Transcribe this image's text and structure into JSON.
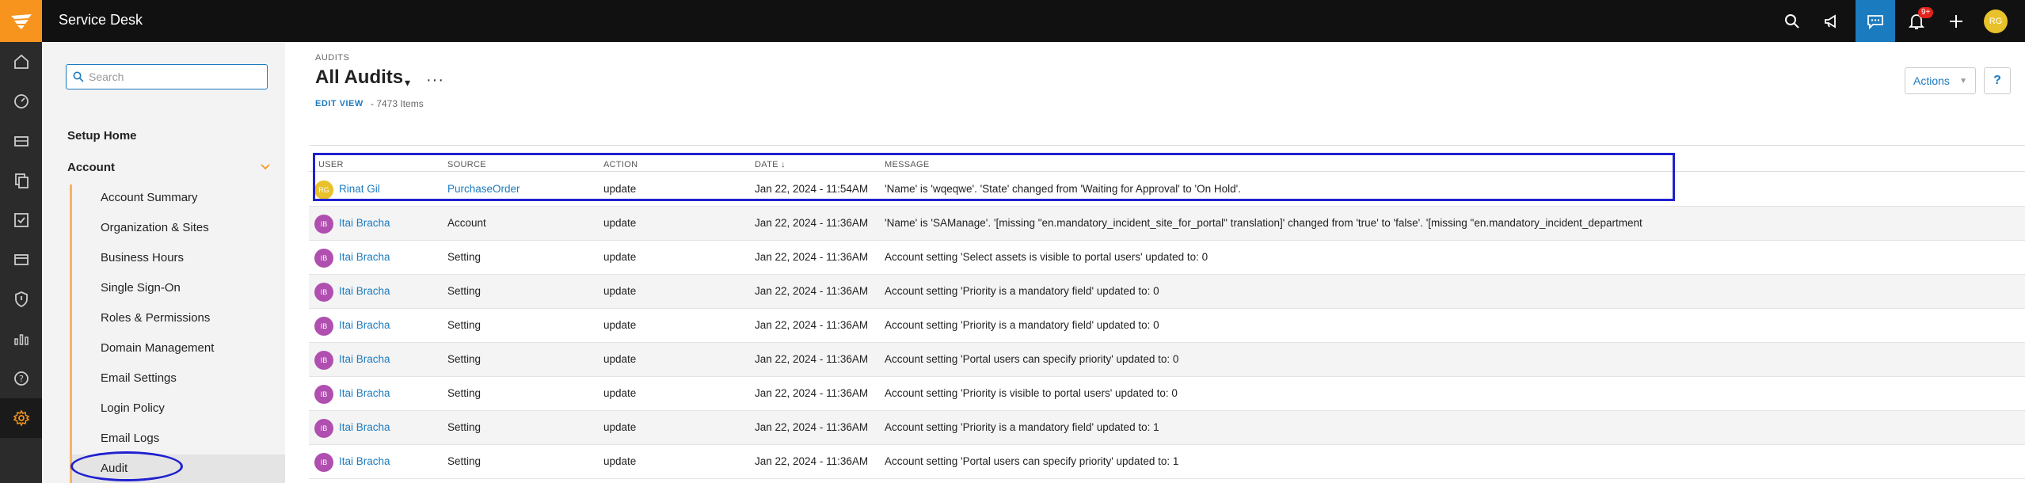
{
  "app": {
    "title": "Service Desk"
  },
  "topbar": {
    "icons": [
      "search-icon",
      "megaphone-icon",
      "chat-icon",
      "bell-icon",
      "plus-icon"
    ],
    "notification_badge": "9+",
    "user_initials": "RG"
  },
  "rail": {
    "items": [
      "home-icon",
      "dashboard-icon",
      "ticket-icon",
      "copy-icon",
      "checkbox-icon",
      "card-icon",
      "shield-icon",
      "analytics-icon",
      "help-icon",
      "settings-icon"
    ]
  },
  "sidebar": {
    "search_placeholder": "Search",
    "setup_home": "Setup Home",
    "account": "Account",
    "items": [
      "Account Summary",
      "Organization & Sites",
      "Business Hours",
      "Single Sign-On",
      "Roles & Permissions",
      "Domain Management",
      "Email Settings",
      "Login Policy",
      "Email Logs",
      "Audit"
    ]
  },
  "main": {
    "breadcrumb": "AUDITS",
    "title": "All Audits",
    "caret": "▾",
    "more": "···",
    "edit_view": "EDIT VIEW",
    "item_count": "- 7473 Items",
    "actions_label": "Actions",
    "actions_caret": "▼",
    "help_label": "?"
  },
  "table": {
    "columns": [
      "USER",
      "SOURCE",
      "ACTION",
      "DATE ↓",
      "MESSAGE"
    ],
    "rows": [
      {
        "initials": "RG",
        "avatar_color": "#e8c12b",
        "user": "Rinat Gil",
        "source": "PurchaseOrder",
        "source_link": true,
        "action": "update",
        "date": "Jan 22, 2024 - 11:54AM",
        "message": "'Name' is 'wqeqwe'. 'State' changed from 'Waiting for Approval' to 'On Hold'."
      },
      {
        "initials": "IB",
        "avatar_color": "#b04fb0",
        "user": "Itai Bracha",
        "source": "Account",
        "source_link": false,
        "action": "update",
        "date": "Jan 22, 2024 - 11:36AM",
        "message": "'Name' is 'SAManage'. '[missing \"en.mandatory_incident_site_for_portal\" translation]' changed from 'true' to 'false'. '[missing \"en.mandatory_incident_department"
      },
      {
        "initials": "IB",
        "avatar_color": "#b04fb0",
        "user": "Itai Bracha",
        "source": "Setting",
        "source_link": false,
        "action": "update",
        "date": "Jan 22, 2024 - 11:36AM",
        "message": "Account setting 'Select assets is visible to portal users' updated to: 0"
      },
      {
        "initials": "IB",
        "avatar_color": "#b04fb0",
        "user": "Itai Bracha",
        "source": "Setting",
        "source_link": false,
        "action": "update",
        "date": "Jan 22, 2024 - 11:36AM",
        "message": "Account setting 'Priority is a mandatory field' updated to: 0"
      },
      {
        "initials": "IB",
        "avatar_color": "#b04fb0",
        "user": "Itai Bracha",
        "source": "Setting",
        "source_link": false,
        "action": "update",
        "date": "Jan 22, 2024 - 11:36AM",
        "message": "Account setting 'Priority is a mandatory field' updated to: 0"
      },
      {
        "initials": "IB",
        "avatar_color": "#b04fb0",
        "user": "Itai Bracha",
        "source": "Setting",
        "source_link": false,
        "action": "update",
        "date": "Jan 22, 2024 - 11:36AM",
        "message": "Account setting 'Portal users can specify priority' updated to: 0"
      },
      {
        "initials": "IB",
        "avatar_color": "#b04fb0",
        "user": "Itai Bracha",
        "source": "Setting",
        "source_link": false,
        "action": "update",
        "date": "Jan 22, 2024 - 11:36AM",
        "message": "Account setting 'Priority is visible to portal users' updated to: 0"
      },
      {
        "initials": "IB",
        "avatar_color": "#b04fb0",
        "user": "Itai Bracha",
        "source": "Setting",
        "source_link": false,
        "action": "update",
        "date": "Jan 22, 2024 - 11:36AM",
        "message": "Account setting 'Priority is a mandatory field' updated to: 1"
      },
      {
        "initials": "IB",
        "avatar_color": "#b04fb0",
        "user": "Itai Bracha",
        "source": "Setting",
        "source_link": false,
        "action": "update",
        "date": "Jan 22, 2024 - 11:36AM",
        "message": "Account setting 'Portal users can specify priority' updated to: 1"
      }
    ]
  }
}
